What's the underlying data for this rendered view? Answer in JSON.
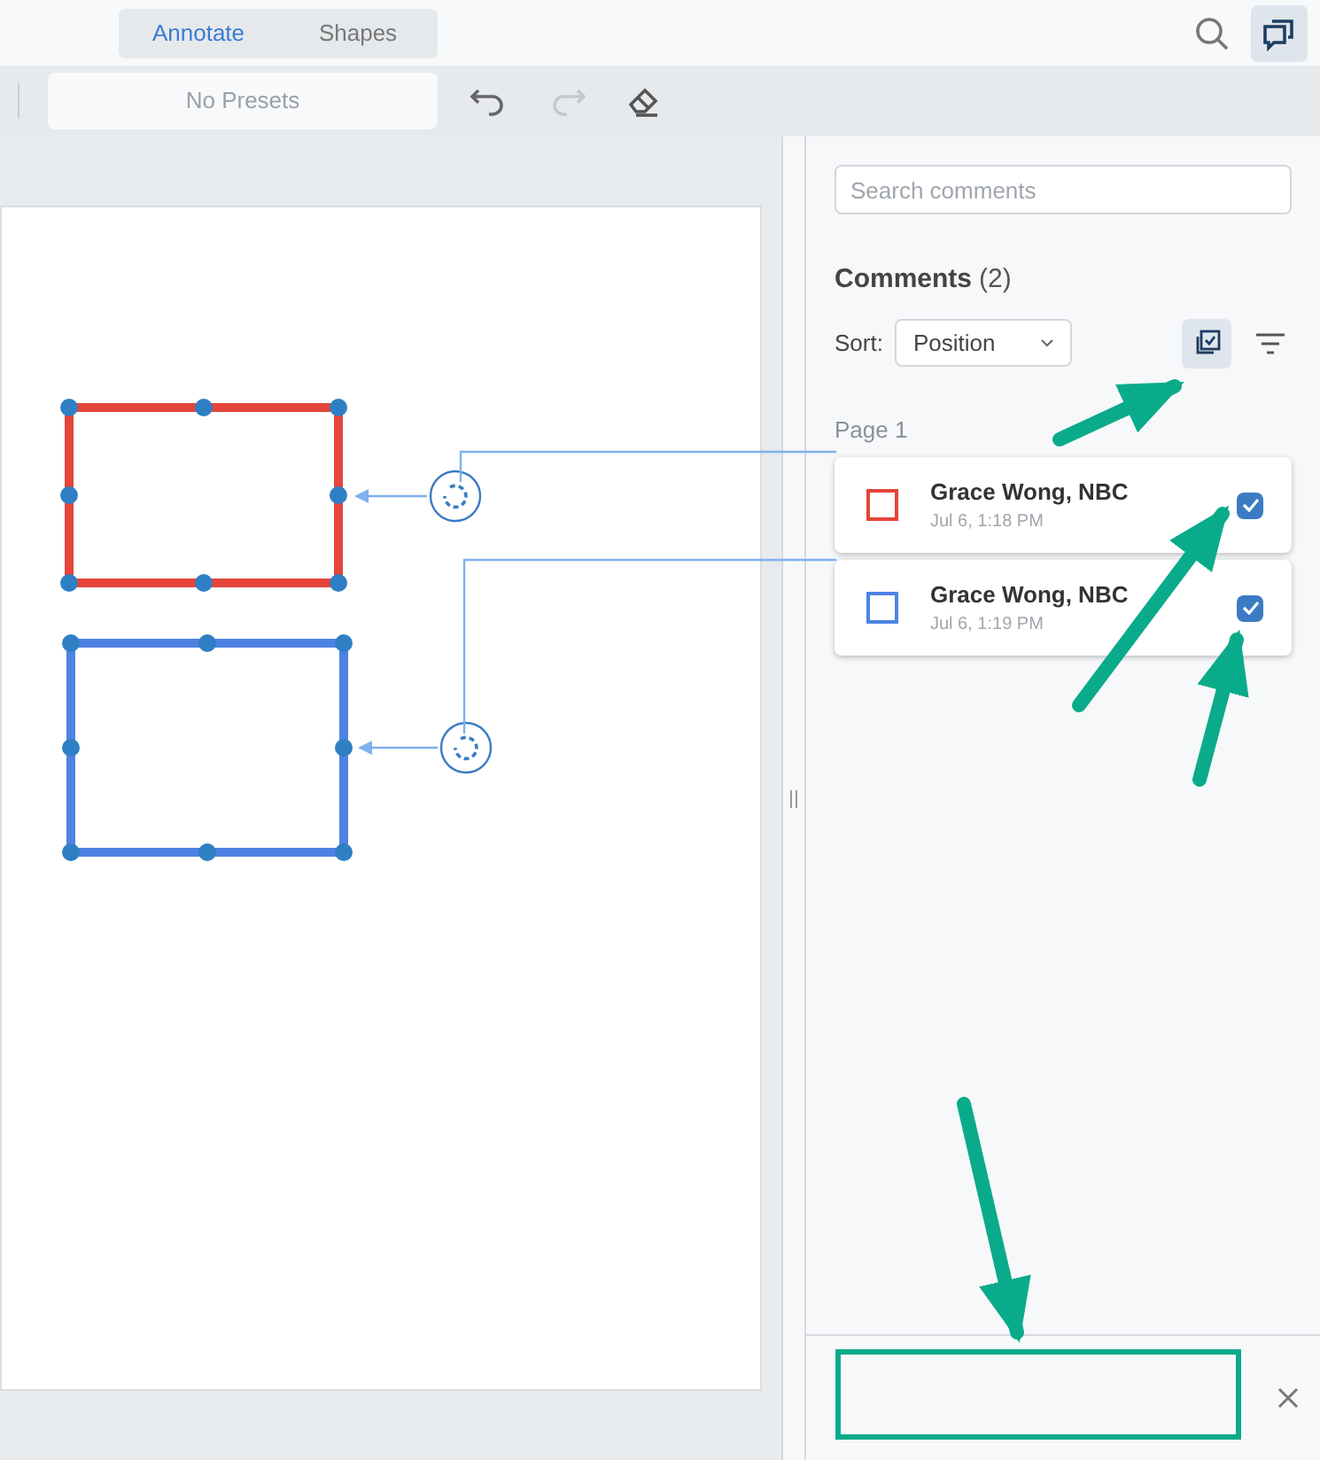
{
  "tabs": [
    {
      "label": "Annotate",
      "selected": true
    },
    {
      "label": "Shapes",
      "selected": false
    }
  ],
  "toolbar": {
    "preset": "No Presets"
  },
  "panel": {
    "search": {
      "placeholder": "Search comments"
    },
    "title": "Comments",
    "count": "(2)",
    "sort_label": "Sort:",
    "sort_value": "Position",
    "group": "Page 1",
    "comments": [
      {
        "author": "Grace Wong, NBC",
        "time": "Jul 6, 1:18 PM",
        "color": "#e5453a",
        "checked": true
      },
      {
        "author": "Grace Wong, NBC",
        "time": "Jul 6, 1:19 PM",
        "color": "#4e82e5",
        "checked": true
      }
    ]
  }
}
